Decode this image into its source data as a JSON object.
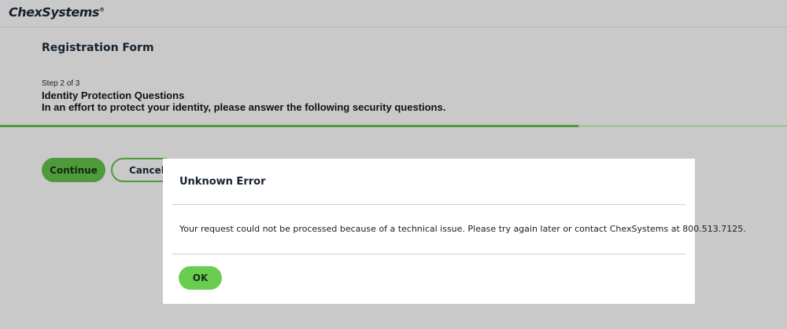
{
  "header": {
    "logo_text": "ChexSystems",
    "logo_mark": "®"
  },
  "form": {
    "title": "Registration Form",
    "step": "Step 2 of 3",
    "section_title": "Identity Protection Questions",
    "section_desc": "In an effort to protect your identity, please answer the following security questions.",
    "progress": 0.735
  },
  "actions": {
    "continue_label": "Continue",
    "cancel_label": "Cancel"
  },
  "modal": {
    "title": "Unknown Error",
    "message": "Your request could not be processed because of a technical issue. Please try again later or contact ChexSystems at 800.513.7125.",
    "ok_label": "OK"
  },
  "colors": {
    "overlay": "#c9c9c9",
    "accent_green": "#4f9a3b",
    "ok_green": "#6bcd4f",
    "progress_track": "#a9c39e",
    "modal_bg": "#ffffff"
  }
}
